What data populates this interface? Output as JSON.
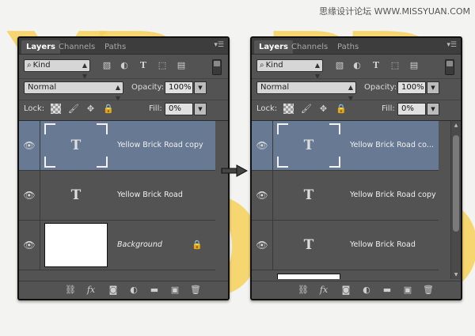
{
  "watermark": "思缘设计论坛 WWW.MISSYUAN.COM",
  "panels": [
    {
      "tabs": [
        "Layers",
        "Channels",
        "Paths"
      ],
      "kind_label": "Kind",
      "blend_mode": "Normal",
      "opacity_label": "Opacity:",
      "opacity_value": "100%",
      "lock_label": "Lock:",
      "fill_label": "Fill:",
      "fill_value": "0%",
      "layers": [
        {
          "name": "Yellow Brick Road copy",
          "type": "text",
          "thumb_glyph": "T",
          "selected": true
        },
        {
          "name": "Yellow Brick Road",
          "type": "text",
          "thumb_glyph": "T",
          "selected": false
        },
        {
          "name": "Background",
          "type": "background",
          "locked": true,
          "selected": false
        }
      ]
    },
    {
      "tabs": [
        "Layers",
        "Channels",
        "Paths"
      ],
      "kind_label": "Kind",
      "blend_mode": "Normal",
      "opacity_label": "Opacity:",
      "opacity_value": "100%",
      "lock_label": "Lock:",
      "fill_label": "Fill:",
      "fill_value": "0%",
      "layers": [
        {
          "name": "Yellow Brick Road co...",
          "type": "text",
          "thumb_glyph": "T",
          "selected": true
        },
        {
          "name": "Yellow Brick Road copy",
          "type": "text",
          "thumb_glyph": "T",
          "selected": false
        },
        {
          "name": "Yellow Brick Road",
          "type": "text",
          "thumb_glyph": "T",
          "selected": false
        }
      ]
    }
  ],
  "icons": {
    "eye": "👁",
    "lock": "🔒",
    "move": "✥",
    "brush": "🖌",
    "search": "⌕",
    "trash": "🗑",
    "link": "⛓",
    "fx": "fx",
    "folder": "▬",
    "new": "▣"
  },
  "colors": {
    "selected_row": "#687a93",
    "panel_bg": "#535353",
    "background_letters": "#f7d25a"
  }
}
